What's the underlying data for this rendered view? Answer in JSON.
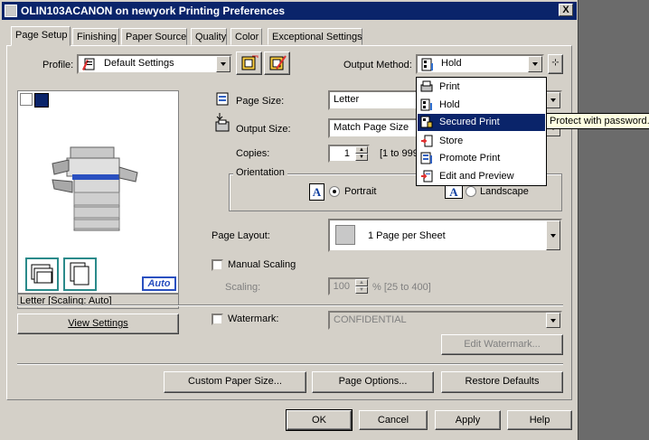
{
  "window": {
    "title": "OLIN103ACANON on newyork Printing Preferences",
    "close_label": "X"
  },
  "tabs": [
    "Page Setup",
    "Finishing",
    "Paper Source",
    "Quality",
    "Color",
    "Exceptional Settings"
  ],
  "profile": {
    "label": "Profile:",
    "value": "Default Settings"
  },
  "output_method": {
    "label": "Output Method:",
    "value": "Hold",
    "options": [
      "Print",
      "Hold",
      "Secured Print",
      "Store",
      "Promote Print",
      "Edit and Preview"
    ],
    "highlighted": "Secured Print"
  },
  "tooltip": "Protect with password.",
  "page_size": {
    "label": "Page Size:",
    "value": "Letter"
  },
  "output_size": {
    "label": "Output Size:",
    "value": "Match Page Size"
  },
  "copies": {
    "label": "Copies:",
    "value": "1",
    "range": "[1 to 999]"
  },
  "orientation": {
    "label": "Orientation",
    "portrait": "Portrait",
    "landscape": "Landscape",
    "selected": "Portrait"
  },
  "page_layout": {
    "label": "Page Layout:",
    "value": "1 Page per Sheet"
  },
  "manual_scaling": {
    "label": "Manual Scaling",
    "checked": false
  },
  "scaling": {
    "label": "Scaling:",
    "value": "100",
    "range": "% [25 to 400]"
  },
  "watermark": {
    "label": "Watermark:",
    "checked": false,
    "value": "CONFIDENTIAL",
    "edit_label": "Edit Watermark..."
  },
  "preview": {
    "status": "Letter [Scaling: Auto]",
    "badge": "Auto",
    "view_settings": "View Settings"
  },
  "buttons": {
    "custom_paper": "Custom Paper Size...",
    "page_options": "Page Options...",
    "restore": "Restore Defaults",
    "ok": "OK",
    "cancel": "Cancel",
    "apply": "Apply",
    "help": "Help"
  },
  "colors": {
    "titlebar": "#0a246a",
    "face": "#d4d0c8",
    "highlight": "#0a246a",
    "tooltip_bg": "#ffffe1"
  }
}
